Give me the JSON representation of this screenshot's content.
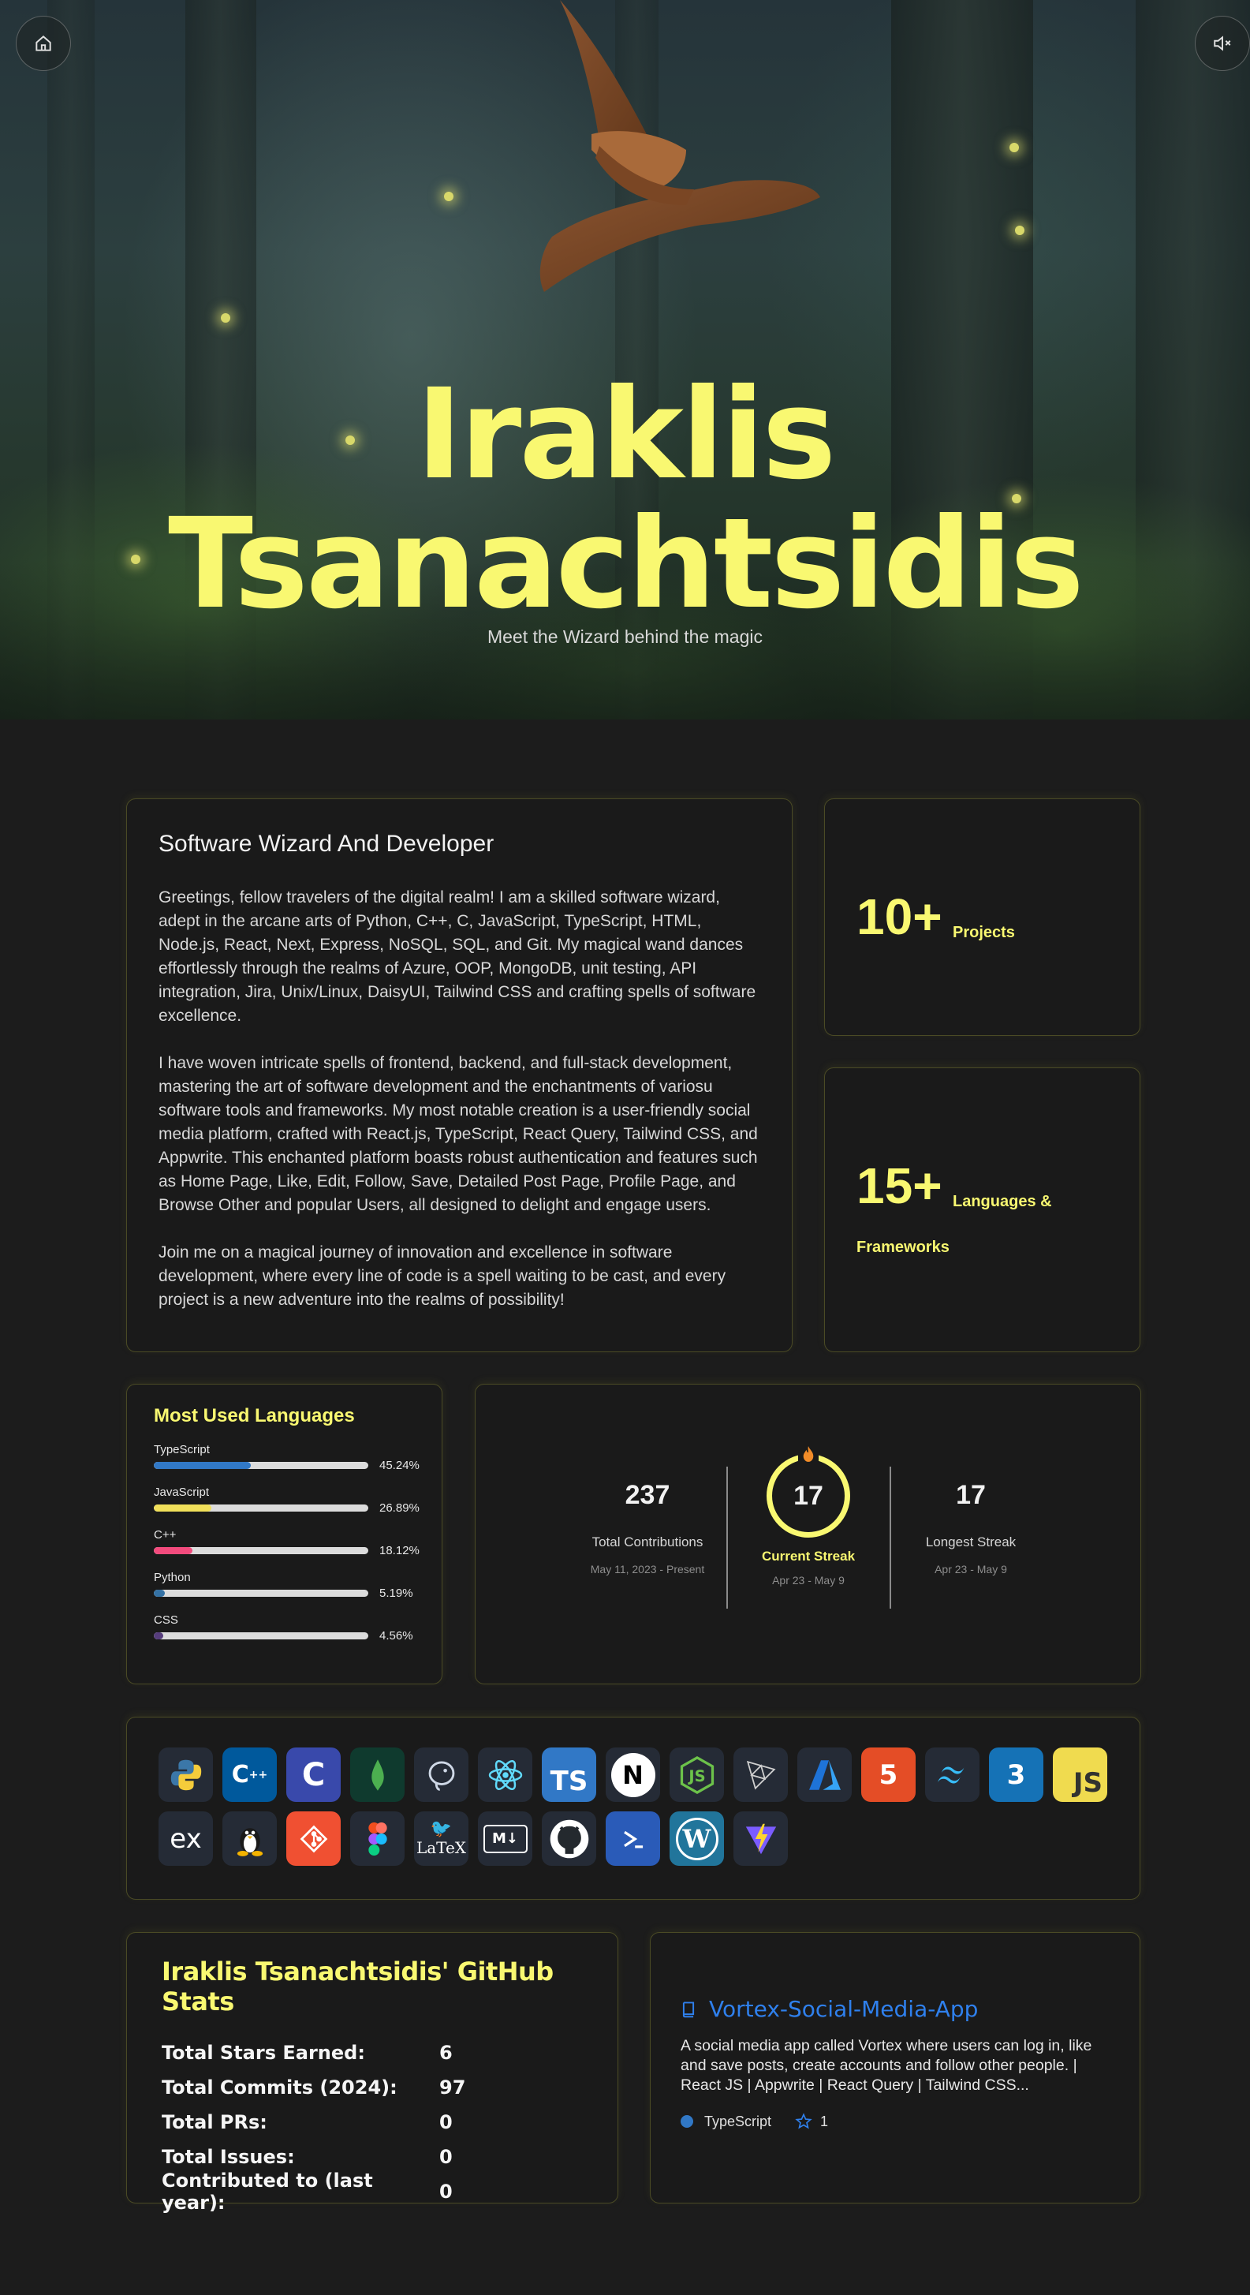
{
  "hero": {
    "first_name": "Iraklis",
    "last_name": "Tsanachtsidis",
    "subtitle": "Meet the Wizard behind the magic",
    "home_icon": "home-icon",
    "mute_icon": "volume-mute-icon"
  },
  "about": {
    "title": "Software Wizard And Developer",
    "paragraphs": [
      "Greetings, fellow travelers of the digital realm! I am a skilled software wizard, adept in the arcane arts of Python, C++, C, JavaScript, TypeScript, HTML, Node.js, React, Next, Express, NoSQL, SQL, and Git. My magical wand dances effortlessly through the realms of Azure, OOP, MongoDB, unit testing, API integration, Jira, Unix/Linux, DaisyUI, Tailwind CSS and crafting spells of software excellence.",
      "I have woven intricate spells of frontend, backend, and full-stack development, mastering the art of software development and the enchantments of variosu software tools and frameworks. My most notable creation is a user-friendly social media platform, crafted with React.js, TypeScript, React Query, Tailwind CSS, and Appwrite. This enchanted platform boasts robust authentication and features such as Home Page, Like, Edit, Follow, Save, Detailed Post Page, Profile Page, and Browse Other and popular Users, all designed to delight and engage users.",
      "Join me on a magical journey of innovation and excellence in software development, where every line of code is a spell waiting to be cast, and every project is a new adventure into the realms of possibility!"
    ]
  },
  "stats": {
    "projects": {
      "value": "10+",
      "label": "Projects"
    },
    "languages": {
      "value": "15+",
      "label_line1": "Languages &",
      "label_line2": "Frameworks"
    }
  },
  "most_used": {
    "title": "Most Used Languages",
    "languages": [
      {
        "name": "TypeScript",
        "percent": "45.24%",
        "fraction": 0.4524,
        "color": "#3178c6"
      },
      {
        "name": "JavaScript",
        "percent": "26.89%",
        "fraction": 0.2689,
        "color": "#f1e05a"
      },
      {
        "name": "C++",
        "percent": "18.12%",
        "fraction": 0.1812,
        "color": "#f34b7d"
      },
      {
        "name": "Python",
        "percent": "5.19%",
        "fraction": 0.0519,
        "color": "#3572a5"
      },
      {
        "name": "CSS",
        "percent": "4.56%",
        "fraction": 0.0456,
        "color": "#563d7c"
      }
    ]
  },
  "streak": {
    "total": {
      "value": "237",
      "label": "Total Contributions",
      "date": "May 11, 2023 - Present"
    },
    "current": {
      "value": "17",
      "label": "Current Streak",
      "date": "Apr 23 - May 9"
    },
    "longest": {
      "value": "17",
      "label": "Longest Streak",
      "date": "Apr 23 - May 9"
    },
    "accent": "#f9f871"
  },
  "tech_icons": [
    "python-icon",
    "cplusplus-icon",
    "c-icon",
    "mongodb-icon",
    "postgresql-icon",
    "react-icon",
    "typescript-icon",
    "nextjs-icon",
    "nodejs-icon",
    "threejs-icon",
    "azure-icon",
    "html5-icon",
    "tailwind-icon",
    "css3-icon",
    "javascript-icon",
    "express-icon",
    "linux-icon",
    "git-icon",
    "figma-icon",
    "latex-icon",
    "markdown-icon",
    "github-icon",
    "powershell-icon",
    "wordpress-icon",
    "vite-icon"
  ],
  "github_stats": {
    "title": "Iraklis Tsanachtsidis' GitHub Stats",
    "rows": [
      {
        "label": "Total Stars Earned:",
        "value": "6"
      },
      {
        "label": "Total Commits (2024):",
        "value": "97"
      },
      {
        "label": "Total PRs:",
        "value": "0"
      },
      {
        "label": "Total Issues:",
        "value": "0"
      },
      {
        "label": "Contributed to (last year):",
        "value": "0"
      }
    ]
  },
  "repo": {
    "name": "Vortex-Social-Media-App",
    "description": "A social media app called Vortex where users can log in, like and save posts, create accounts and follow other people. | React JS | Appwrite | React Query | Tailwind CSS...",
    "language": "TypeScript",
    "language_color": "#3178c6",
    "stars": "1"
  }
}
